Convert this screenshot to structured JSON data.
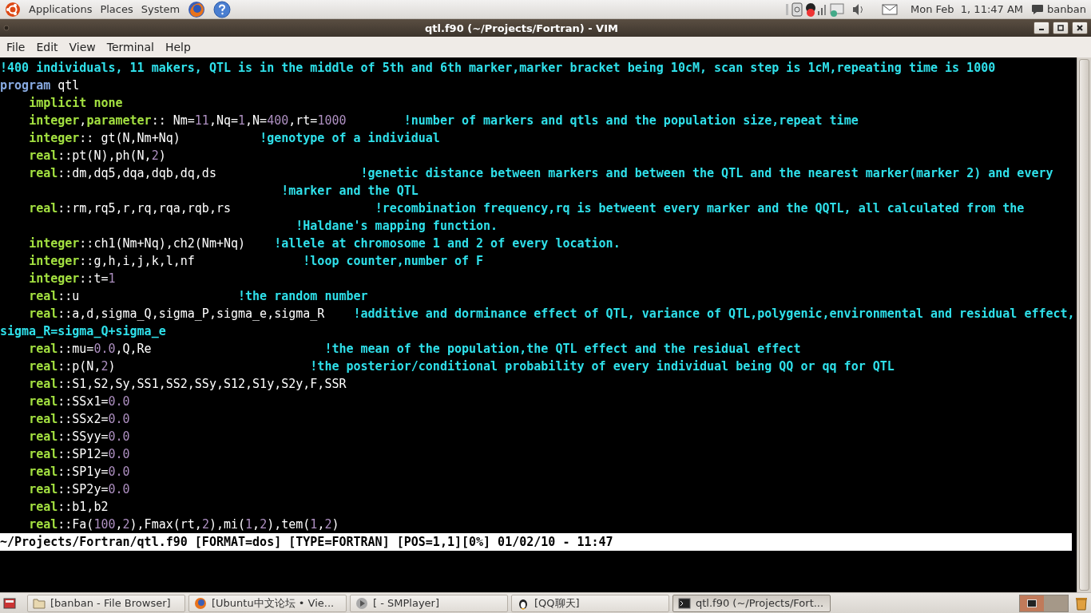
{
  "top_panel": {
    "menus": [
      "Applications",
      "Places",
      "System"
    ],
    "clock": "Mon Feb  1, 11:47 AM",
    "user": "banban"
  },
  "window": {
    "title": "qtl.f90 (~/Projects/Fortran) - VIM"
  },
  "menu_bar": [
    "File",
    "Edit",
    "View",
    "Terminal",
    "Help"
  ],
  "code_lines": [
    [
      {
        "kind": "comment",
        "text": "!400 individuals, 11 makers, QTL is in the middle of 5th and 6th marker,marker bracket being 10cM, scan step is 1cM,repeating time is 1000"
      }
    ],
    [
      {
        "kind": "keyword",
        "text": "program"
      },
      {
        "kind": "plain",
        "text": " qtl"
      }
    ],
    [
      {
        "kind": "type",
        "text": "    implicit none"
      }
    ],
    [
      {
        "kind": "type",
        "text": "    integer"
      },
      {
        "kind": "plain",
        "text": ","
      },
      {
        "kind": "type",
        "text": "parameter"
      },
      {
        "kind": "plain",
        "text": ":: Nm="
      },
      {
        "kind": "number",
        "text": "11"
      },
      {
        "kind": "plain",
        "text": ",Nq="
      },
      {
        "kind": "number",
        "text": "1"
      },
      {
        "kind": "plain",
        "text": ",N="
      },
      {
        "kind": "number",
        "text": "400"
      },
      {
        "kind": "plain",
        "text": ",rt="
      },
      {
        "kind": "number",
        "text": "1000"
      },
      {
        "kind": "comment",
        "text": "        !number of markers and qtls and the population size,repeat time"
      }
    ],
    [
      {
        "kind": "type",
        "text": "    integer"
      },
      {
        "kind": "plain",
        "text": ":: gt(N,Nm+Nq)"
      },
      {
        "kind": "comment",
        "text": "           !genotype of a individual"
      }
    ],
    [
      {
        "kind": "type",
        "text": "    real"
      },
      {
        "kind": "plain",
        "text": "::pt(N),ph(N,"
      },
      {
        "kind": "number",
        "text": "2"
      },
      {
        "kind": "plain",
        "text": ")"
      }
    ],
    [
      {
        "kind": "type",
        "text": "    real"
      },
      {
        "kind": "plain",
        "text": "::dm,dq5,dqa,dqb,dq,ds"
      },
      {
        "kind": "comment",
        "text": "                    !genetic distance between markers and between the QTL and the nearest marker(marker 2) and every"
      }
    ],
    [
      {
        "kind": "comment",
        "text": "                                       !marker and the QTL"
      }
    ],
    [
      {
        "kind": "type",
        "text": "    real"
      },
      {
        "kind": "plain",
        "text": "::rm,rq5,r,rq,rqa,rqb,rs"
      },
      {
        "kind": "comment",
        "text": "                    !recombination frequency,rq is betweent every marker and the QQTL, all calculated from the"
      }
    ],
    [
      {
        "kind": "comment",
        "text": "                                         !Haldane's mapping function."
      }
    ],
    [
      {
        "kind": "type",
        "text": "    integer"
      },
      {
        "kind": "plain",
        "text": "::ch1(Nm+Nq),ch2(Nm+Nq)"
      },
      {
        "kind": "comment",
        "text": "    !allele at chromosome 1 and 2 of every location."
      }
    ],
    [
      {
        "kind": "type",
        "text": "    integer"
      },
      {
        "kind": "plain",
        "text": "::g,h,i,j,k,l,nf"
      },
      {
        "kind": "comment",
        "text": "               !loop counter,number of F"
      }
    ],
    [
      {
        "kind": "type",
        "text": "    integer"
      },
      {
        "kind": "plain",
        "text": "::t="
      },
      {
        "kind": "number",
        "text": "1"
      }
    ],
    [
      {
        "kind": "type",
        "text": "    real"
      },
      {
        "kind": "plain",
        "text": "::u"
      },
      {
        "kind": "comment",
        "text": "                      !the random number"
      }
    ],
    [
      {
        "kind": "type",
        "text": "    real"
      },
      {
        "kind": "plain",
        "text": "::a,d,sigma_Q,sigma_P,sigma_e,sigma_R"
      },
      {
        "kind": "comment",
        "text": "    !additive and dorminance effect of QTL, variance of QTL,polygenic,environmental and residual effect,"
      }
    ],
    [
      {
        "kind": "comment",
        "text": "sigma_R=sigma_Q+sigma_e"
      }
    ],
    [
      {
        "kind": "type",
        "text": "    real"
      },
      {
        "kind": "plain",
        "text": "::mu="
      },
      {
        "kind": "number",
        "text": "0.0"
      },
      {
        "kind": "plain",
        "text": ",Q,Re"
      },
      {
        "kind": "comment",
        "text": "                        !the mean of the population,the QTL effect and the residual effect"
      }
    ],
    [
      {
        "kind": "type",
        "text": "    real"
      },
      {
        "kind": "plain",
        "text": "::p(N,"
      },
      {
        "kind": "number",
        "text": "2"
      },
      {
        "kind": "plain",
        "text": ")"
      },
      {
        "kind": "comment",
        "text": "                           !the posterior/conditional probability of every individual being QQ or qq for QTL"
      }
    ],
    [
      {
        "kind": "type",
        "text": "    real"
      },
      {
        "kind": "plain",
        "text": "::S1,S2,Sy,SS1,SS2,SSy,S12,S1y,S2y,F,SSR"
      }
    ],
    [
      {
        "kind": "type",
        "text": "    real"
      },
      {
        "kind": "plain",
        "text": "::SSx1="
      },
      {
        "kind": "number",
        "text": "0.0"
      }
    ],
    [
      {
        "kind": "type",
        "text": "    real"
      },
      {
        "kind": "plain",
        "text": "::SSx2="
      },
      {
        "kind": "number",
        "text": "0.0"
      }
    ],
    [
      {
        "kind": "type",
        "text": "    real"
      },
      {
        "kind": "plain",
        "text": "::SSyy="
      },
      {
        "kind": "number",
        "text": "0.0"
      }
    ],
    [
      {
        "kind": "type",
        "text": "    real"
      },
      {
        "kind": "plain",
        "text": "::SP12="
      },
      {
        "kind": "number",
        "text": "0.0"
      }
    ],
    [
      {
        "kind": "type",
        "text": "    real"
      },
      {
        "kind": "plain",
        "text": "::SP1y="
      },
      {
        "kind": "number",
        "text": "0.0"
      }
    ],
    [
      {
        "kind": "type",
        "text": "    real"
      },
      {
        "kind": "plain",
        "text": "::SP2y="
      },
      {
        "kind": "number",
        "text": "0.0"
      }
    ],
    [
      {
        "kind": "type",
        "text": "    real"
      },
      {
        "kind": "plain",
        "text": "::b1,b2"
      }
    ],
    [
      {
        "kind": "type",
        "text": "    real"
      },
      {
        "kind": "plain",
        "text": "::Fa("
      },
      {
        "kind": "number",
        "text": "100"
      },
      {
        "kind": "plain",
        "text": ","
      },
      {
        "kind": "number",
        "text": "2"
      },
      {
        "kind": "plain",
        "text": "),Fmax(rt,"
      },
      {
        "kind": "number",
        "text": "2"
      },
      {
        "kind": "plain",
        "text": "),mi("
      },
      {
        "kind": "number",
        "text": "1"
      },
      {
        "kind": "plain",
        "text": ","
      },
      {
        "kind": "number",
        "text": "2"
      },
      {
        "kind": "plain",
        "text": "),tem("
      },
      {
        "kind": "number",
        "text": "1"
      },
      {
        "kind": "plain",
        "text": ","
      },
      {
        "kind": "number",
        "text": "2"
      },
      {
        "kind": "plain",
        "text": ")"
      }
    ]
  ],
  "status_line": "~/Projects/Fortran/qtl.f90 [FORMAT=dos] [TYPE=FORTRAN] [POS=1,1][0%] 01/02/10 - 11:47",
  "taskbar": [
    {
      "label": "[banban - File Browser]",
      "kind": "folder",
      "selected": false
    },
    {
      "label": "[Ubuntu中文论坛 • Vie...",
      "kind": "globe",
      "selected": false
    },
    {
      "label": "[ - SMPlayer]",
      "kind": "player",
      "selected": false
    },
    {
      "label": "[QQ聊天]",
      "kind": "penguin",
      "selected": false
    },
    {
      "label": "qtl.f90 (~/Projects/Fort...",
      "kind": "terminal",
      "selected": true
    }
  ]
}
